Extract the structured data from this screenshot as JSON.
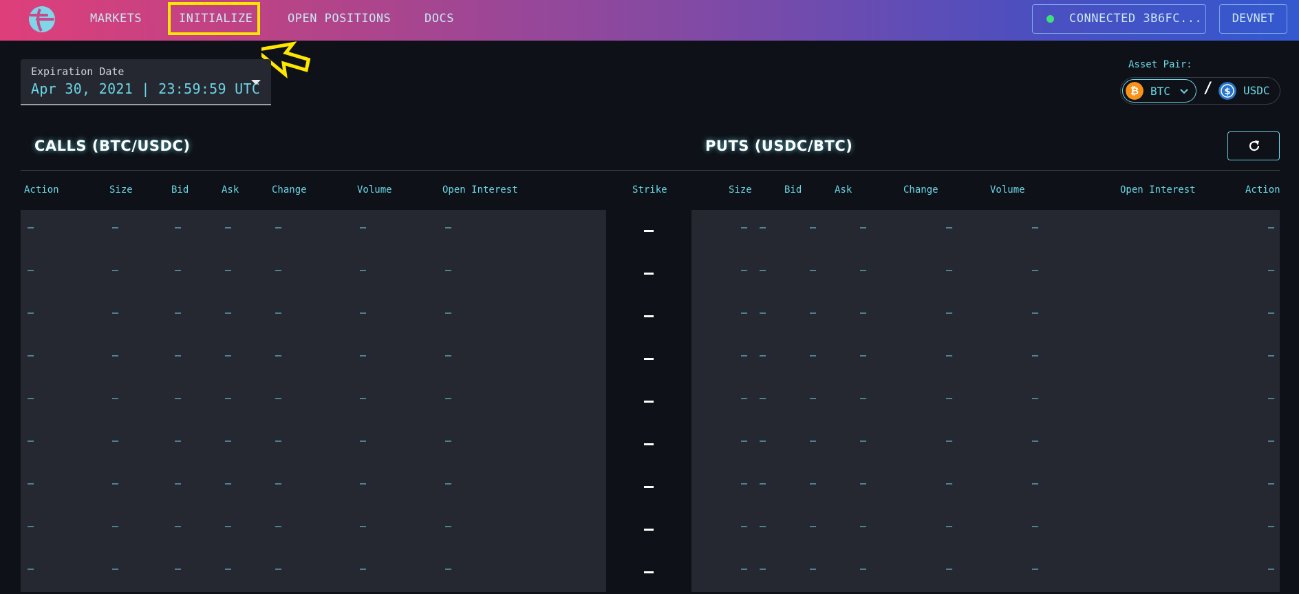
{
  "nav": {
    "links": [
      "MARKETS",
      "INITIALIZE",
      "OPEN POSITIONS",
      "DOCS"
    ],
    "connected_label": "CONNECTED 3B6FC...",
    "network_label": "DEVNET",
    "status_color": "#3ee07a"
  },
  "expiration": {
    "label": "Expiration Date",
    "value": "Apr 30, 2021 | 23:59:59 UTC"
  },
  "asset_pair": {
    "label": "Asset Pair:",
    "base": "BTC",
    "slash": "/",
    "quote": "USDC"
  },
  "calls": {
    "title": "CALLS (BTC/USDC)",
    "headers": [
      "Action",
      "Size",
      "Bid",
      "Ask",
      "Change",
      "Volume",
      "Open Interest"
    ]
  },
  "strike_header": "Strike",
  "puts": {
    "title": "PUTS (USDC/BTC)",
    "headers": [
      "Size",
      "Bid",
      "Ask",
      "Change",
      "Volume",
      "Open Interest",
      "Action"
    ]
  },
  "empty_cell": "–",
  "row_count": 9,
  "colors": {
    "accent": "#6ad6e6",
    "highlight": "#ffe600",
    "background": "#0e1117",
    "panel": "#262831"
  }
}
